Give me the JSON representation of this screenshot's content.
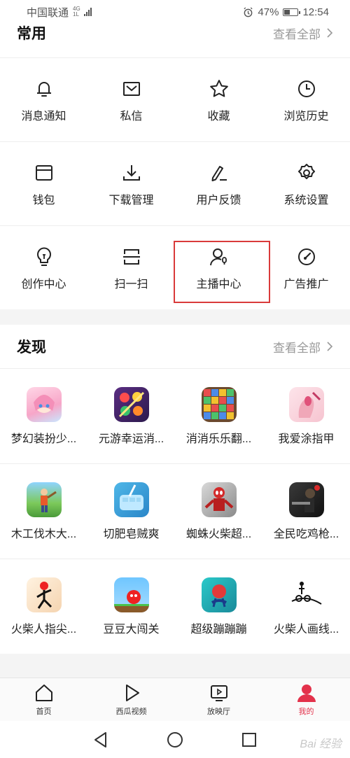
{
  "status": {
    "carrier": "中国联通",
    "net_top": "4G",
    "net_bottom": "1L",
    "battery": "47%",
    "battery_level": 0.47,
    "time": "12:54"
  },
  "common": {
    "title": "常用",
    "see_all": "查看全部",
    "rows": [
      [
        {
          "label": "消息通知",
          "icon": "bell-icon"
        },
        {
          "label": "私信",
          "icon": "mail-icon"
        },
        {
          "label": "收藏",
          "icon": "star-icon"
        },
        {
          "label": "浏览历史",
          "icon": "clock-icon"
        }
      ],
      [
        {
          "label": "钱包",
          "icon": "wallet-icon"
        },
        {
          "label": "下载管理",
          "icon": "download-icon"
        },
        {
          "label": "用户反馈",
          "icon": "feedback-icon"
        },
        {
          "label": "系统设置",
          "icon": "gear-icon"
        }
      ],
      [
        {
          "label": "创作中心",
          "icon": "bulb-icon"
        },
        {
          "label": "扫一扫",
          "icon": "scan-icon"
        },
        {
          "label": "主播中心",
          "icon": "streamer-icon"
        },
        {
          "label": "广告推广",
          "icon": "gauge-icon"
        }
      ]
    ]
  },
  "discover": {
    "title": "发现",
    "see_all": "查看全部",
    "rows": [
      [
        {
          "label": "梦幻装扮少..."
        },
        {
          "label": "元游幸运消..."
        },
        {
          "label": "消消乐乐翻..."
        },
        {
          "label": "我爱涂指甲"
        }
      ],
      [
        {
          "label": "木工伐木大..."
        },
        {
          "label": "切肥皂贼爽"
        },
        {
          "label": "蜘蛛火柴超..."
        },
        {
          "label": "全民吃鸡枪..."
        }
      ],
      [
        {
          "label": "火柴人指尖..."
        },
        {
          "label": "豆豆大闯关"
        },
        {
          "label": "超级蹦蹦蹦"
        },
        {
          "label": "火柴人画线..."
        }
      ]
    ]
  },
  "tabs": [
    {
      "label": "首页"
    },
    {
      "label": "西瓜视频"
    },
    {
      "label": "放映厅"
    },
    {
      "label": "我的"
    }
  ],
  "colors": {
    "accent": "#e3324b",
    "highlight": "#d93a3a",
    "muted": "#999999"
  },
  "watermark": "Bai 经验"
}
